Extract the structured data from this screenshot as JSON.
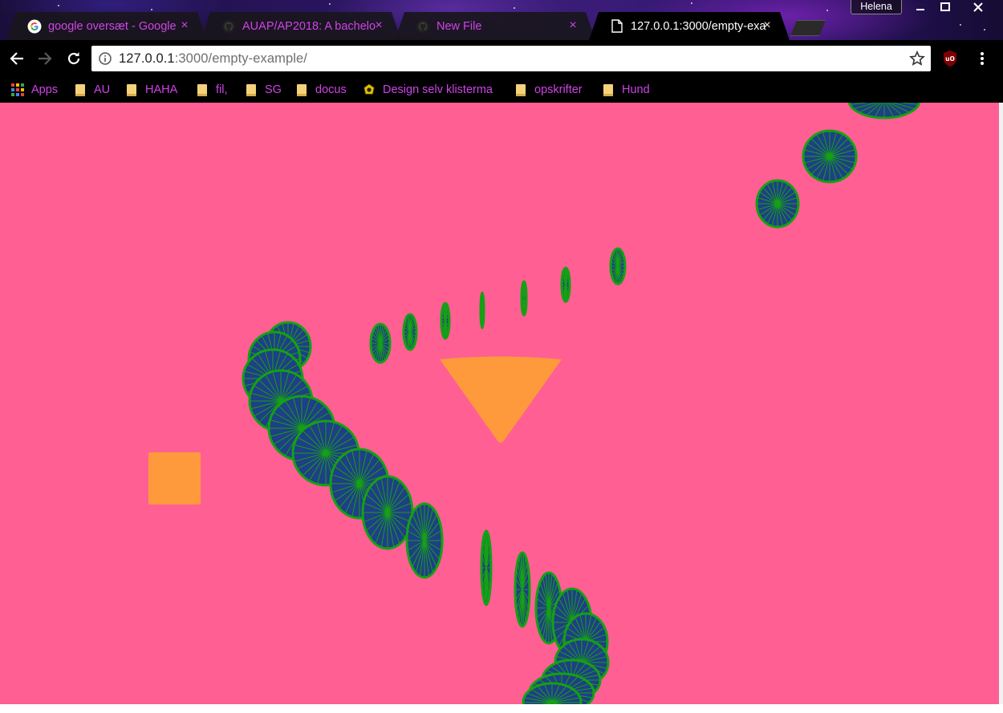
{
  "browser": {
    "profile_name": "Helena",
    "tabs": [
      {
        "title": "google oversæt - Google",
        "icon": "google-g-icon",
        "active": false
      },
      {
        "title": "AUAP/AP2018: A bachelo",
        "icon": "github-icon",
        "active": false
      },
      {
        "title": "New File",
        "icon": "github-icon",
        "active": false
      },
      {
        "title": "127.0.0.1:3000/empty-exa",
        "icon": "document-icon",
        "active": true
      }
    ],
    "close_glyph": "×",
    "address": {
      "host": "127.0.0.1",
      "path": ":3000/empty-example/"
    },
    "bookmarks": [
      {
        "label": "Apps",
        "icon": "apps-grid-icon"
      },
      {
        "label": "AU",
        "icon": "folder-icon"
      },
      {
        "label": "HAHA",
        "icon": "folder-icon"
      },
      {
        "label": "fil,",
        "icon": "folder-icon"
      },
      {
        "label": "SG",
        "icon": "folder-icon"
      },
      {
        "label": "docus",
        "icon": "folder-icon"
      },
      {
        "label": "Design selv klisterma",
        "icon": "sticker-site-icon"
      },
      {
        "label": "opskrifter",
        "icon": "folder-icon"
      },
      {
        "label": "Hund",
        "icon": "folder-icon"
      }
    ]
  },
  "colors": {
    "page_background": "#ff5f93",
    "chrome_black": "#000000",
    "tab_text": "#cf43e8",
    "bookmark_text": "#cf43e8",
    "shape_orange": "#ff9a3c",
    "wheel_fill": "#1f3f86",
    "wheel_stroke": "#15a015"
  },
  "sketch": {
    "shapes": [
      "orange-square",
      "orange-triangle",
      "spinning-wheels"
    ],
    "wheel_spokes": 24
  }
}
